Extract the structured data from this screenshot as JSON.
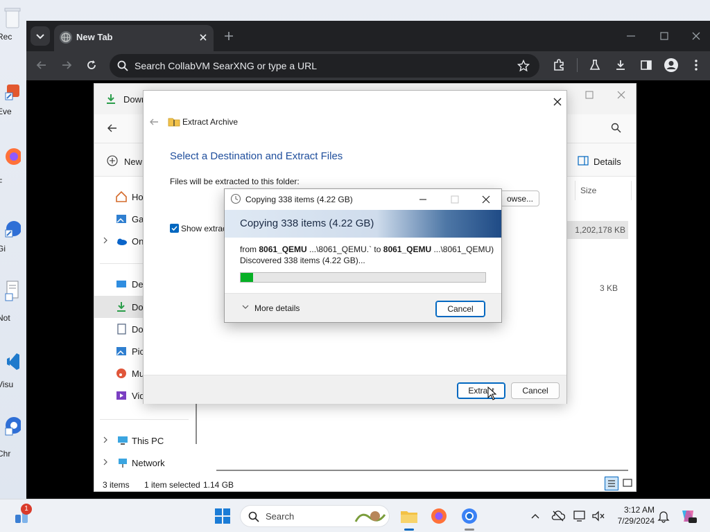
{
  "desktop": {
    "icons": [
      {
        "label": "Rec",
        "icon": "recycle-bin-icon"
      },
      {
        "label": "Eve",
        "icon": "shortcut-app-icon"
      },
      {
        "label": "F",
        "icon": "firefox-icon"
      },
      {
        "label": "Gi",
        "icon": "shortcut-app-icon"
      },
      {
        "label": "Not",
        "icon": "notepad-icon"
      },
      {
        "label": "Visu",
        "icon": "vscode-icon"
      },
      {
        "label": "Chr",
        "icon": "chrome-icon"
      }
    ]
  },
  "browser": {
    "tab_title": "New Tab",
    "omnibox_placeholder": "Search CollabVM SearXNG or type a URL",
    "icons": [
      "tab-search-icon",
      "globe-icon",
      "close-icon",
      "new-tab-icon",
      "minimize-icon",
      "maximize-icon",
      "close-window-icon",
      "back-icon",
      "forward-icon",
      "reload-icon",
      "search-icon",
      "star-icon",
      "extensions-icon",
      "labs-icon",
      "download-icon",
      "side-panel-icon",
      "profile-icon",
      "menu-icon"
    ]
  },
  "explorer": {
    "title_partial": "Dowr",
    "new_label": "New",
    "details_label": "Details",
    "column_size": "Size",
    "rows": [
      {
        "size": "1,202,178 KB"
      },
      {
        "size": "3 KB"
      }
    ],
    "nav_items": [
      {
        "label": "Ho",
        "icon": "home-icon"
      },
      {
        "label": "Gal",
        "icon": "gallery-icon"
      },
      {
        "label": "On",
        "icon": "onedrive-icon"
      },
      {
        "label": "Des",
        "icon": "desktop-folder-icon"
      },
      {
        "label": "Dow",
        "icon": "downloads-icon"
      },
      {
        "label": "Doc",
        "icon": "documents-icon"
      },
      {
        "label": "Pic",
        "icon": "pictures-icon"
      },
      {
        "label": "Mu",
        "icon": "music-icon"
      },
      {
        "label": "Vid",
        "icon": "videos-icon"
      },
      {
        "label": "This PC",
        "icon": "this-pc-icon"
      },
      {
        "label": "Network",
        "icon": "network-icon"
      }
    ],
    "status": {
      "items": "3 items",
      "selected": "1 item selected",
      "size": "1.14 GB"
    }
  },
  "wizard": {
    "title": "Extract Archive",
    "heading": "Select a Destination and Extract Files",
    "folder_label": "Files will be extracted to this folder:",
    "browse_partial": "owse...",
    "show_partial": "Show extract",
    "show_checked": true,
    "extract_label": "Extract",
    "cancel_label": "Cancel"
  },
  "copy_dialog": {
    "title": "Copying 338 items (4.22 GB)",
    "banner": "Copying 338 items (4.22 GB)",
    "from_label": "from",
    "from_name": "8061_QEMU",
    "from_path": " ...\\8061_QEMU.` to ",
    "to_name": "8061_QEMU",
    "to_path": " ...\\8061_QEMU)",
    "discovered": "Discovered 338 items (4.22 GB)...",
    "progress": 0.05,
    "more_details": "More details",
    "cancel_label": "Cancel"
  },
  "taskbar": {
    "search_label": "Search",
    "notification_count": "1",
    "time": "3:12 AM",
    "date": "7/29/2024"
  },
  "colors": {
    "accent": "#0067c0",
    "progress_fill": "#06b025",
    "chrome_dark": "#202124",
    "chrome_toolbar": "#35363a",
    "heading_blue": "#1f4e9c"
  }
}
